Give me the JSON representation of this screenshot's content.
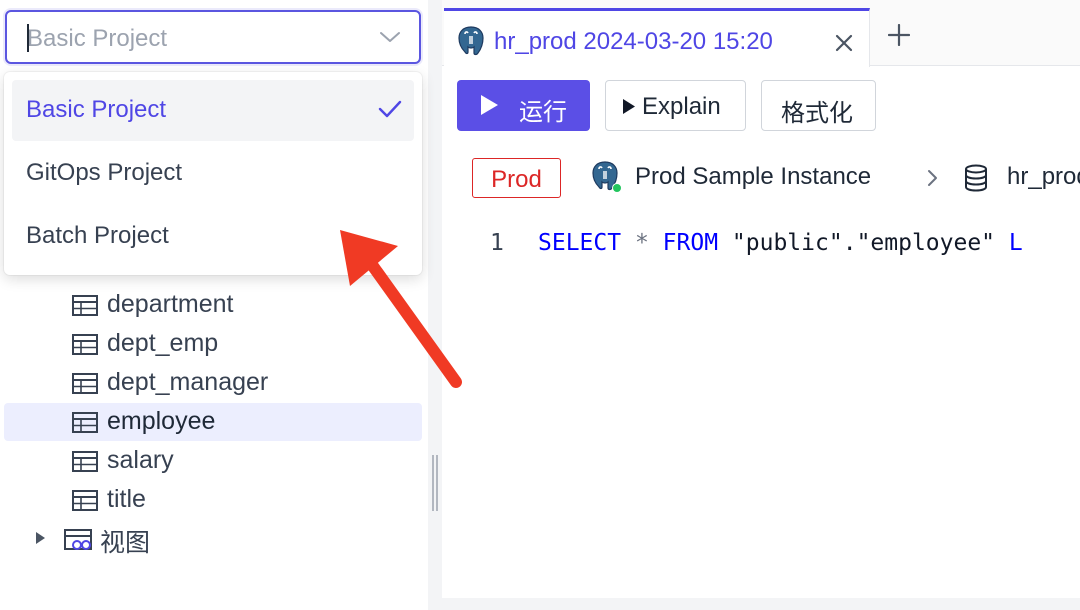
{
  "project_selector": {
    "value": "Basic Project",
    "options": [
      {
        "label": "Basic Project",
        "selected": true
      },
      {
        "label": "GitOps Project",
        "selected": false
      },
      {
        "label": "Batch Project",
        "selected": false
      }
    ]
  },
  "schema_tree": {
    "tables": [
      {
        "label": "department",
        "active": false
      },
      {
        "label": "dept_emp",
        "active": false
      },
      {
        "label": "dept_manager",
        "active": false
      },
      {
        "label": "employee",
        "active": true
      },
      {
        "label": "salary",
        "active": false
      },
      {
        "label": "title",
        "active": false
      }
    ],
    "views_label": "视图"
  },
  "tabs": {
    "active_tab_title": "hr_prod 2024-03-20 15:20"
  },
  "toolbar": {
    "run_label": "运行",
    "explain_label": "Explain",
    "format_label": "格式化"
  },
  "context": {
    "environment": "Prod",
    "instance": "Prod Sample Instance",
    "database": "hr_prod"
  },
  "editor": {
    "line_number": "1",
    "tokens": {
      "select": "SELECT",
      "star": "*",
      "from": "FROM",
      "schema": "\"public\"",
      "dot": ".",
      "table": "\"employee\"",
      "tail": "L"
    }
  },
  "colors": {
    "accent": "#4f46e5",
    "run_button": "#5b4fe6",
    "prod_badge": "#dc2626",
    "status_online": "#22c55e",
    "annotation_arrow": "#f03a24"
  },
  "icons": {
    "tree_table": "table-icon",
    "tree_view": "view-icon",
    "engine": "postgresql-elephant-icon",
    "database": "database-icon"
  }
}
